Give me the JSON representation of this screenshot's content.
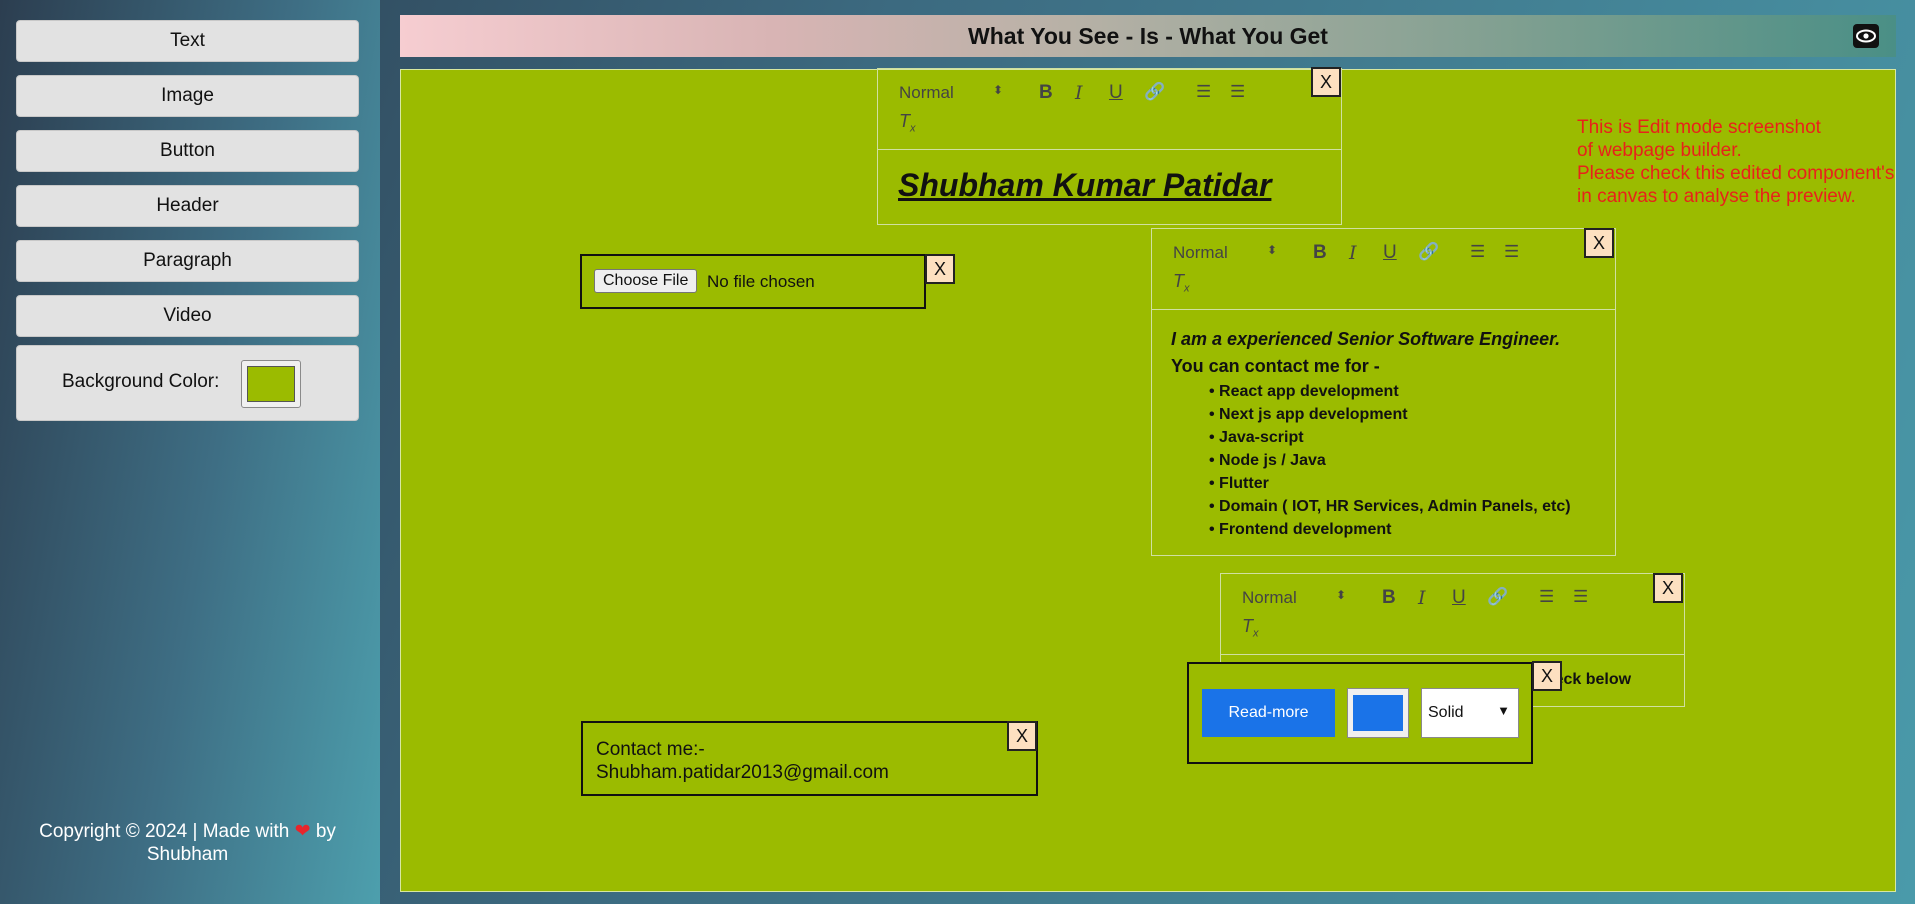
{
  "sidebar": {
    "items": [
      "Text",
      "Image",
      "Button",
      "Header",
      "Paragraph",
      "Video"
    ],
    "bg_label": "Background Color:",
    "bg_color": "#9bbb00"
  },
  "footer": {
    "prefix": "Copyright © 2024 | Made with",
    "suffix": "by",
    "author": "Shubham"
  },
  "header": {
    "title": "What You See - Is - What You Get",
    "preview_icon": "eye-icon"
  },
  "canvas": {
    "bg": "#9bbb00"
  },
  "note": {
    "line1": "This is Edit mode screenshot",
    "line2": "of webpage builder.",
    "line3": "Please check this edited component's",
    "line4": "in canvas to analyse the preview."
  },
  "editor": {
    "style_select": "Normal",
    "close": "X"
  },
  "name_block": {
    "text": "Shubham Kumar Patidar"
  },
  "file_input": {
    "button": "Choose File",
    "status": "No file chosen"
  },
  "about": {
    "line1": "I am a experienced Senior Software Engineer.",
    "line2": "You can contact me for -",
    "skills": [
      "React app development",
      "Next js app development",
      "Java-script",
      "Node js / Java",
      "Flutter",
      "Domain ( IOT, HR Services, Admin Panels, etc)",
      "Frontend development"
    ]
  },
  "more": {
    "text": "Want's to know more about me :-- let's check below"
  },
  "button_block": {
    "label": "Read-more",
    "color": "#1a73e8",
    "border_style": "Solid"
  },
  "contact": {
    "line1": "Contact me:-",
    "line2": "Shubham.patidar2013@gmail.com"
  }
}
